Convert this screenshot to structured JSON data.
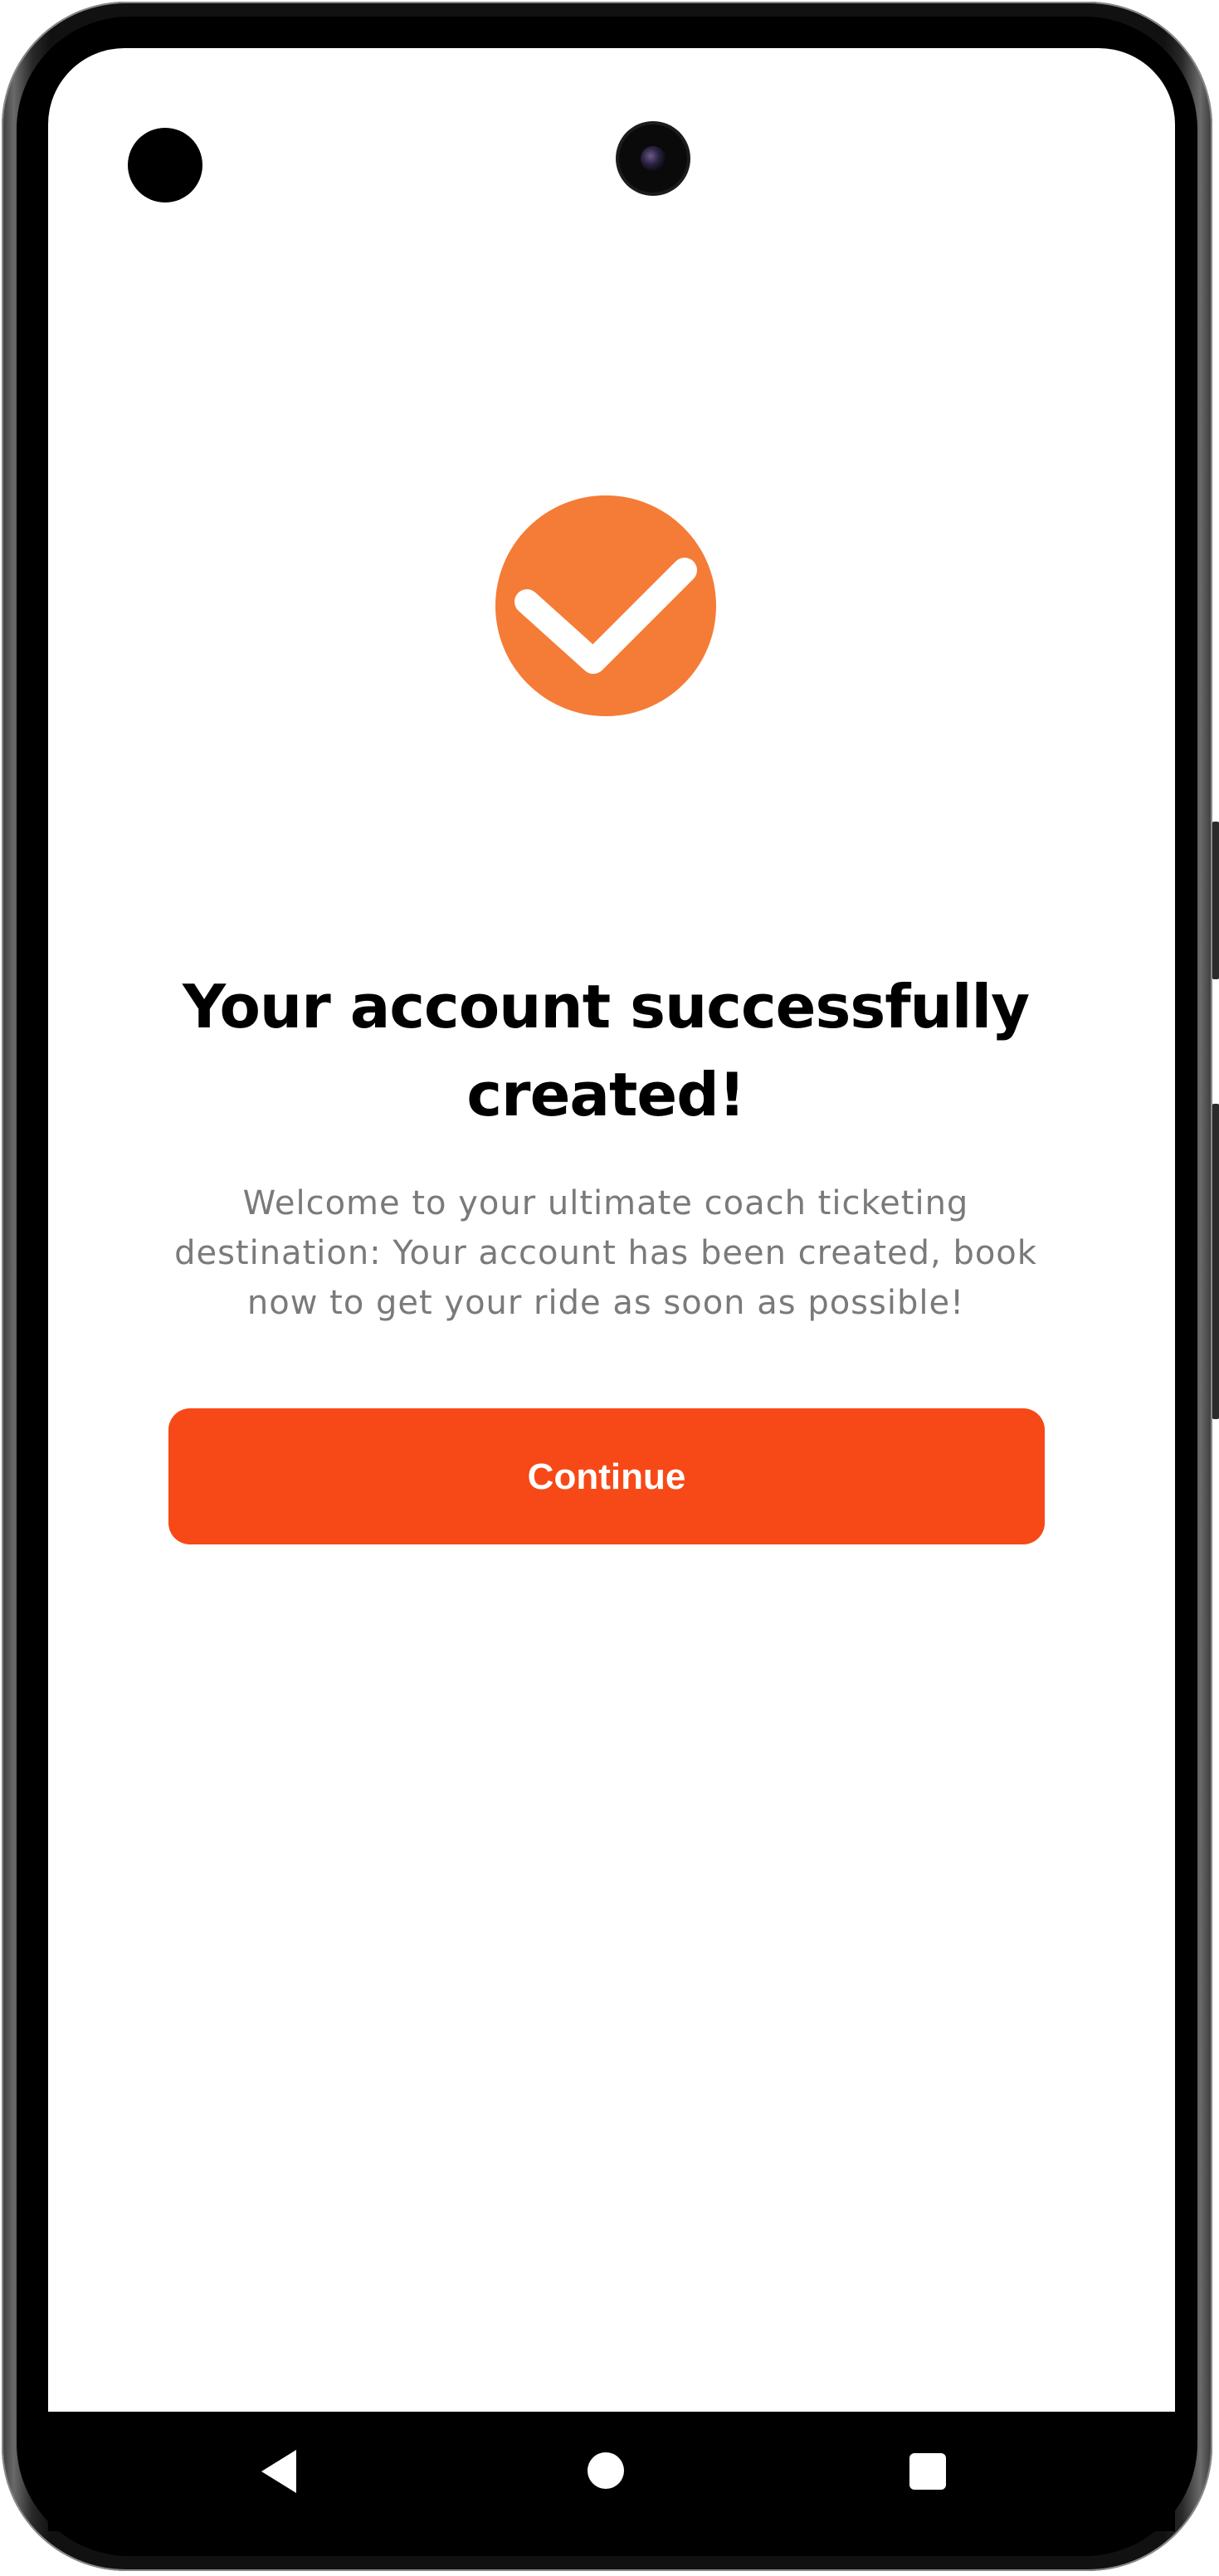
{
  "colors": {
    "accent_icon": "#f47c36",
    "button_bg": "#f74917",
    "button_text": "#ffffff",
    "title": "#000000",
    "subtitle": "#7a7a7a",
    "nav_bar": "#000000"
  },
  "success": {
    "icon": "checkmark-circle-icon",
    "title": "Your account successfully created!",
    "message": "Welcome to your ultimate coach ticketing destination: Your account has been created, book now to get your ride as soon as possible!"
  },
  "actions": {
    "continue_label": "Continue"
  },
  "navigation": {
    "back_icon": "back-triangle-icon",
    "home_icon": "home-circle-icon",
    "recents_icon": "recents-square-icon"
  }
}
